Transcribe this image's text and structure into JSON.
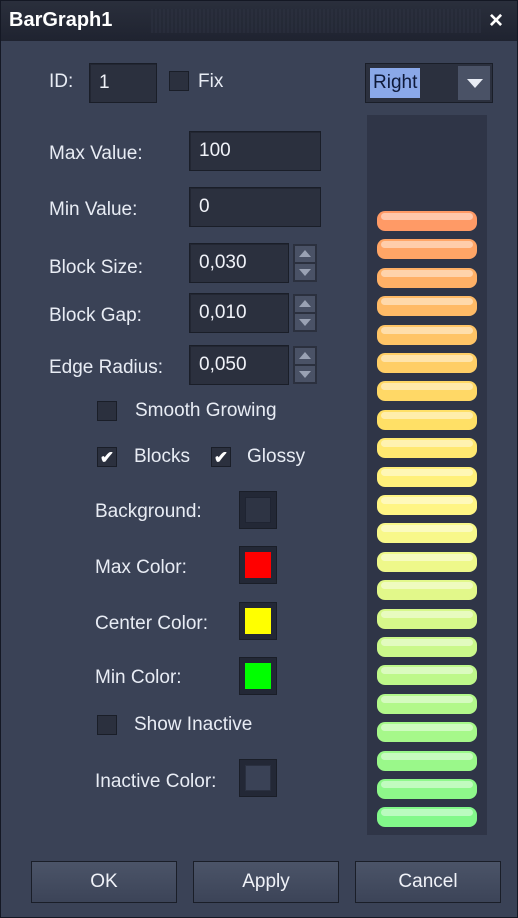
{
  "window": {
    "title": "BarGraph1",
    "close": "×"
  },
  "form": {
    "id_label": "ID:",
    "id_value": "1",
    "fix_label": "Fix",
    "fix_checked": false,
    "orientation": "Right",
    "max_value_label": "Max Value:",
    "max_value": "100",
    "min_value_label": "Min Value:",
    "min_value": "0",
    "block_size_label": "Block Size:",
    "block_size": "0,030",
    "block_gap_label": "Block Gap:",
    "block_gap": "0,010",
    "edge_radius_label": "Edge Radius:",
    "edge_radius": "0,050",
    "smooth_growing_label": "Smooth Growing",
    "smooth_growing_checked": false,
    "blocks_label": "Blocks",
    "blocks_mark": "✔",
    "glossy_label": "Glossy",
    "glossy_mark": "✔",
    "background_label": "Background:",
    "max_color_label": "Max Color:",
    "center_color_label": "Center Color:",
    "min_color_label": "Min Color:",
    "show_inactive_label": "Show Inactive",
    "inactive_color_label": "Inactive Color:"
  },
  "colors": {
    "background": "#2e3444",
    "max": "#ff0000",
    "center": "#ffff00",
    "min": "#00ff00",
    "inactive": "#3a4256",
    "preview_blocks": [
      "#ff9a66",
      "#ffa566",
      "#ffb066",
      "#ffba66",
      "#ffc466",
      "#ffce66",
      "#ffd866",
      "#ffe066",
      "#ffe870",
      "#fff07a",
      "#fff584",
      "#f8f88a",
      "#eef88a",
      "#e2f88a",
      "#d6f88a",
      "#caf88a",
      "#bef88a",
      "#b2f88a",
      "#a6f88a",
      "#9af88a",
      "#8ef88a",
      "#82f88a"
    ]
  },
  "buttons": {
    "ok": "OK",
    "apply": "Apply",
    "cancel": "Cancel"
  }
}
